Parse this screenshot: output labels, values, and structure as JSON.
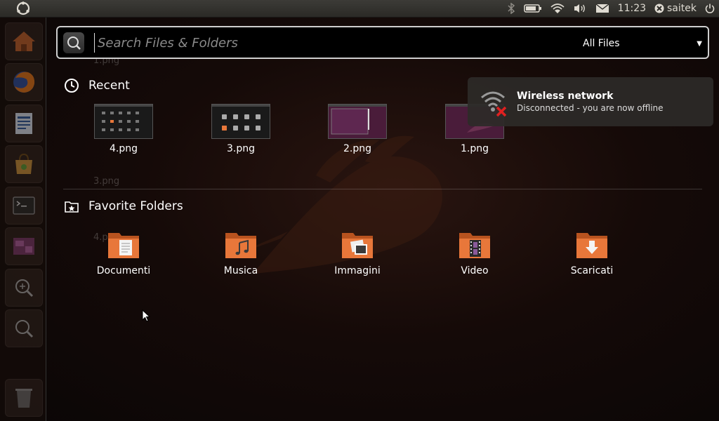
{
  "panel": {
    "time": "11:23",
    "user": "saitek"
  },
  "launcher": {
    "items": [
      {
        "icon": "home-folder-icon"
      },
      {
        "icon": "firefox-icon"
      },
      {
        "icon": "writer-icon"
      },
      {
        "icon": "software-center-icon"
      },
      {
        "icon": "terminal-icon"
      },
      {
        "icon": "workspaces-icon"
      },
      {
        "icon": "apps-lens-icon"
      },
      {
        "icon": "files-lens-icon"
      },
      {
        "icon": "trash-icon"
      }
    ]
  },
  "search": {
    "placeholder": "Search Files & Folders",
    "value": "",
    "filter_label": "All Files"
  },
  "recent": {
    "title": "Recent",
    "items": [
      {
        "label": "4.png"
      },
      {
        "label": "3.png"
      },
      {
        "label": "2.png"
      },
      {
        "label": "1.png"
      }
    ]
  },
  "favorites": {
    "title": "Favorite Folders",
    "items": [
      {
        "label": "Documenti",
        "icon": "documents-folder-icon"
      },
      {
        "label": "Musica",
        "icon": "music-folder-icon"
      },
      {
        "label": "Immagini",
        "icon": "pictures-folder-icon"
      },
      {
        "label": "Video",
        "icon": "video-folder-icon"
      },
      {
        "label": "Scaricati",
        "icon": "downloads-folder-icon"
      }
    ]
  },
  "notification": {
    "title": "Wireless network",
    "body": "Disconnected - you are now offline"
  },
  "ghost_labels": [
    "1.png",
    "3.png",
    "4.png"
  ],
  "colors": {
    "folder_orange": "#e8773a",
    "ubuntu_purple": "#5e2750",
    "error_red": "#e02020"
  }
}
